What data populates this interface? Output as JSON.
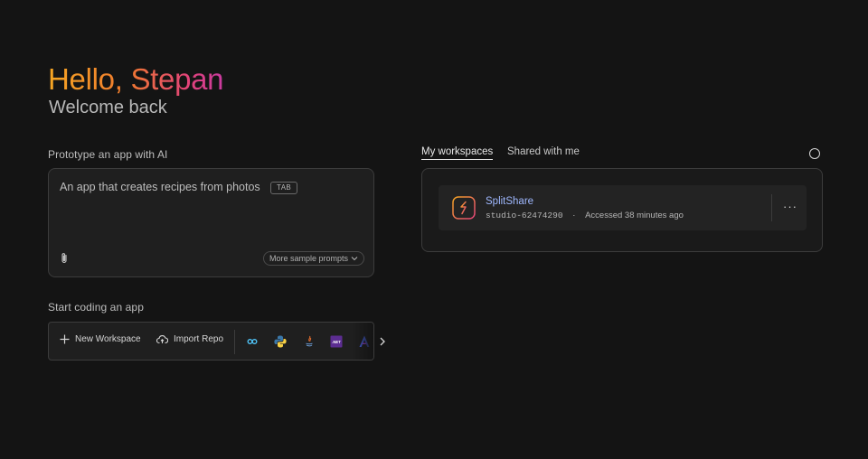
{
  "header": {
    "greeting": "Hello, Stepan",
    "subtitle": "Welcome back"
  },
  "prototype": {
    "label": "Prototype an app with AI",
    "placeholder": "An app that creates recipes from photos",
    "tab_hint": "TAB",
    "sample_prompts": "More sample prompts",
    "attach_icon": "paperclip-icon"
  },
  "coding": {
    "label": "Start coding an app",
    "new_workspace": "New Workspace",
    "import_repo": "Import Repo",
    "templates": [
      "flutter",
      "python",
      "java",
      ".NET",
      "angular"
    ],
    "net_label": ".NET"
  },
  "workspaces": {
    "tabs": [
      "My workspaces",
      "Shared with me"
    ],
    "active_tab": "My workspaces",
    "items": [
      {
        "name": "SplitShare",
        "id": "studio-62474290",
        "separator": "·",
        "accessed": "Accessed 38 minutes ago",
        "more": "···"
      }
    ]
  },
  "colors": {
    "background": "#141414",
    "accent_link": "#9fb8ff",
    "brand_orange": "#f07a2e"
  }
}
